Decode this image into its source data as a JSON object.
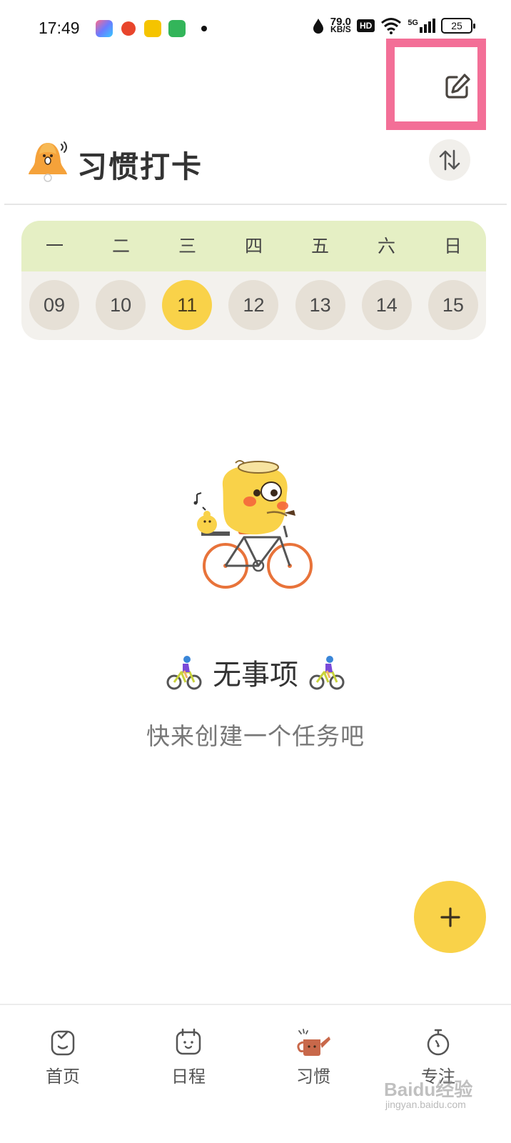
{
  "status_bar": {
    "time": "17:49",
    "net_speed_value": "79.0",
    "net_speed_unit": "KB/S",
    "hd_label": "HD",
    "network_label": "5G",
    "battery_level": "25"
  },
  "header": {
    "title": "习惯打卡"
  },
  "calendar": {
    "weekdays": [
      "一",
      "二",
      "三",
      "四",
      "五",
      "六",
      "日"
    ],
    "dates": [
      "09",
      "10",
      "11",
      "12",
      "13",
      "14",
      "15"
    ],
    "selected_date": "11"
  },
  "empty_state": {
    "title": "无事项",
    "subtitle": "快来创建一个任务吧"
  },
  "fab": {
    "label": "+"
  },
  "bottom_nav": {
    "items": [
      {
        "label": "首页",
        "icon": "home-icon"
      },
      {
        "label": "日程",
        "icon": "calendar-face-icon"
      },
      {
        "label": "习惯",
        "icon": "watering-can-icon"
      },
      {
        "label": "专注",
        "icon": "stopwatch-icon"
      }
    ]
  },
  "watermark": {
    "text": "Baidu经验",
    "url_text": "jingyan.baidu.com"
  },
  "colors": {
    "accent_yellow": "#f9d249",
    "weekday_bg": "#e5efc4",
    "date_bg": "#e6e0d6",
    "highlight_pink": "#f36f97"
  }
}
